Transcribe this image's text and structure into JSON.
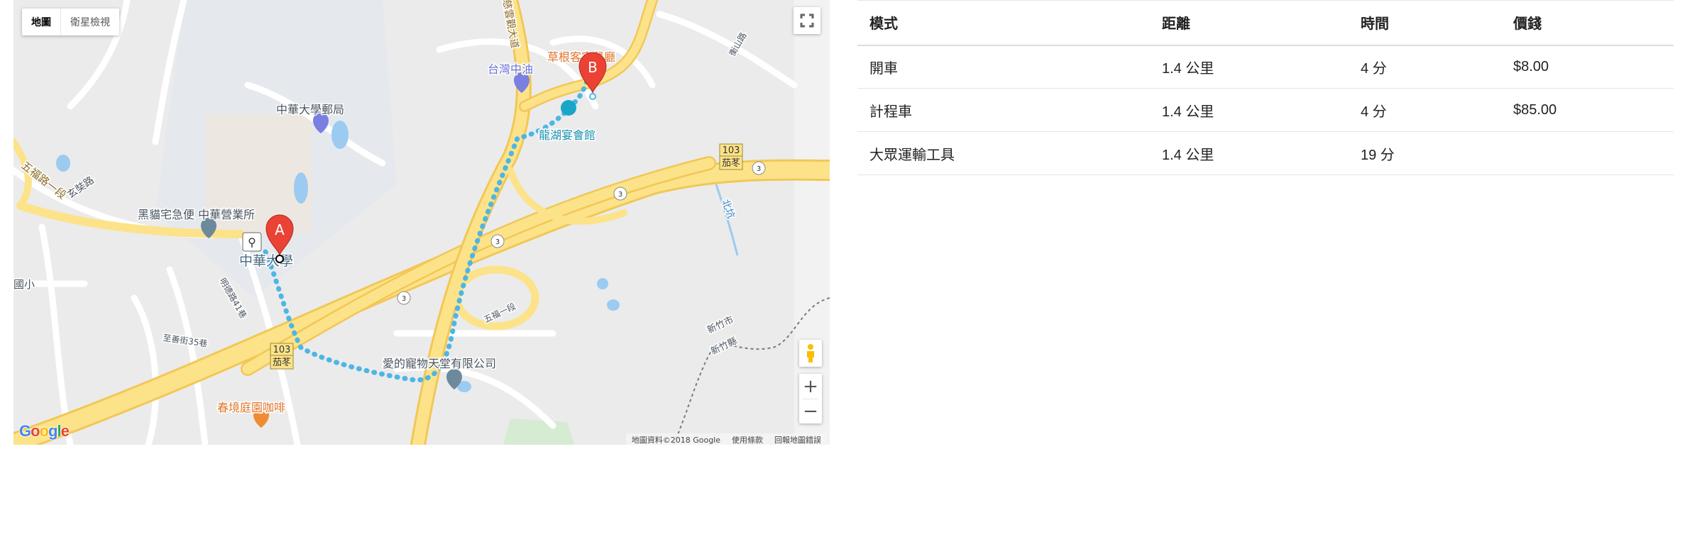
{
  "map": {
    "type_control": {
      "map_label": "地圖",
      "satellite_label": "衛星檢視"
    },
    "labels": {
      "university_post": "中華大學郵局",
      "university": "中華大學",
      "delivery": "黑貓宅急便 中華營業所",
      "gas_station": "台灣中油",
      "restaurant": "草根客家餐廳",
      "banquet": "龍湖宴會館",
      "pet": "愛的寵物天堂有限公司",
      "cafe": "春境庭園咖啡",
      "road_wufu": "五福路一段",
      "road_xuanzang": "玄奘路",
      "road_avenue": "慈雲觀大道",
      "river": "北坑",
      "route_code": "103",
      "route_name": "茄苳",
      "highway": "3",
      "road_lane41": "明德路41巷",
      "road_lane35": "至善街35巷",
      "road_wufu1": "五福一段",
      "road_xinzhu": "新竹縣",
      "road_xinzhu_city": "新竹市",
      "lane_hengshan": "衡山路",
      "place_left": "國小"
    },
    "markers": {
      "start": "A",
      "end": "B"
    },
    "zoom": {
      "in": "+",
      "out": "−"
    },
    "attribution": {
      "data": "地圖資料©2018 Google",
      "terms": "使用條款",
      "report": "回報地圖錯誤"
    },
    "logo": "Google",
    "colors": {
      "route": "#4db6e5",
      "highway": "#fce38a",
      "highway_edge": "#f2c756",
      "marker": "#ea4335"
    }
  },
  "table": {
    "headers": [
      "模式",
      "距離",
      "時間",
      "價錢"
    ],
    "rows": [
      {
        "mode": "開車",
        "distance": "1.4 公里",
        "time": "4 分",
        "price": "$8.00"
      },
      {
        "mode": "計程車",
        "distance": "1.4 公里",
        "time": "4 分",
        "price": "$85.00"
      },
      {
        "mode": "大眾運輸工具",
        "distance": "1.4 公里",
        "time": "19 分",
        "price": ""
      }
    ]
  }
}
